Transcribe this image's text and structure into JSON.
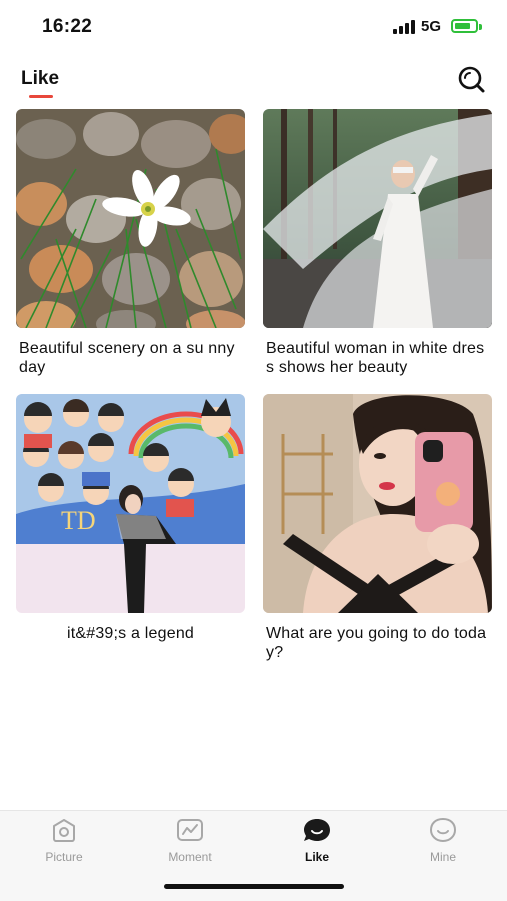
{
  "status_bar": {
    "time": "16:22",
    "network": "5G",
    "battery_icon": "battery-charging-icon",
    "signal_icon": "signal-bars-icon"
  },
  "header": {
    "title": "Like",
    "accent_color": "#e8473b",
    "search_icon": "search-icon"
  },
  "feed": {
    "cards": [
      {
        "title": "Beautiful scenery on a su nny day",
        "image": "white flower among pebbles and grass"
      },
      {
        "title": "Beautiful woman in white dress shows her beauty",
        "image": "woman in white dress with flowing veil in forest"
      },
      {
        "title": "it&#39;s a legend",
        "image": "woman posing in front of colorful cartoon mural"
      },
      {
        "title": "What are you going to do today?",
        "image": "woman taking mirror selfie with pink phone"
      }
    ]
  },
  "tab_bar": {
    "tabs": [
      {
        "label": "Picture",
        "icon": "picture-icon",
        "active": false
      },
      {
        "label": "Moment",
        "icon": "moment-icon",
        "active": false
      },
      {
        "label": "Like",
        "icon": "like-chat-icon",
        "active": true
      },
      {
        "label": "Mine",
        "icon": "mine-face-icon",
        "active": false
      }
    ],
    "active_color": "#111111",
    "inactive_color": "#9a9a9a"
  }
}
